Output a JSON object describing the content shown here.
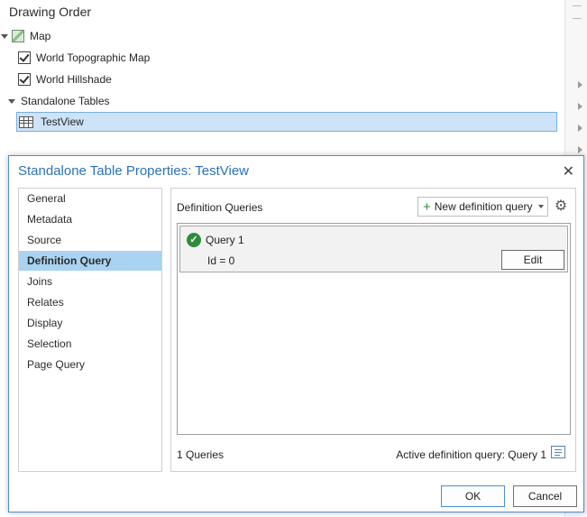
{
  "contents": {
    "title": "Drawing Order",
    "map": "Map",
    "layers": [
      "World Topographic Map",
      "World Hillshade"
    ],
    "standalone_tables": "Standalone Tables",
    "table": "TestView"
  },
  "dialog": {
    "title": "Standalone Table Properties: TestView",
    "close": "✕",
    "nav": [
      "General",
      "Metadata",
      "Source",
      "Definition Query",
      "Joins",
      "Relates",
      "Display",
      "Selection",
      "Page Query"
    ],
    "active_nav": "Definition Query",
    "section_label": "Definition Queries",
    "new_query_label": "New definition query",
    "query": {
      "name": "Query 1",
      "expression": "Id = 0",
      "edit_label": "Edit"
    },
    "query_count": "1 Queries",
    "active_query": "Active definition query: Query 1",
    "ok_label": "OK",
    "cancel_label": "Cancel"
  },
  "colors": {
    "accent": "#2d72b8",
    "selected": "#a9d3f1",
    "tree_selected": "#cde3f7",
    "valid": "#2e8b3c"
  }
}
